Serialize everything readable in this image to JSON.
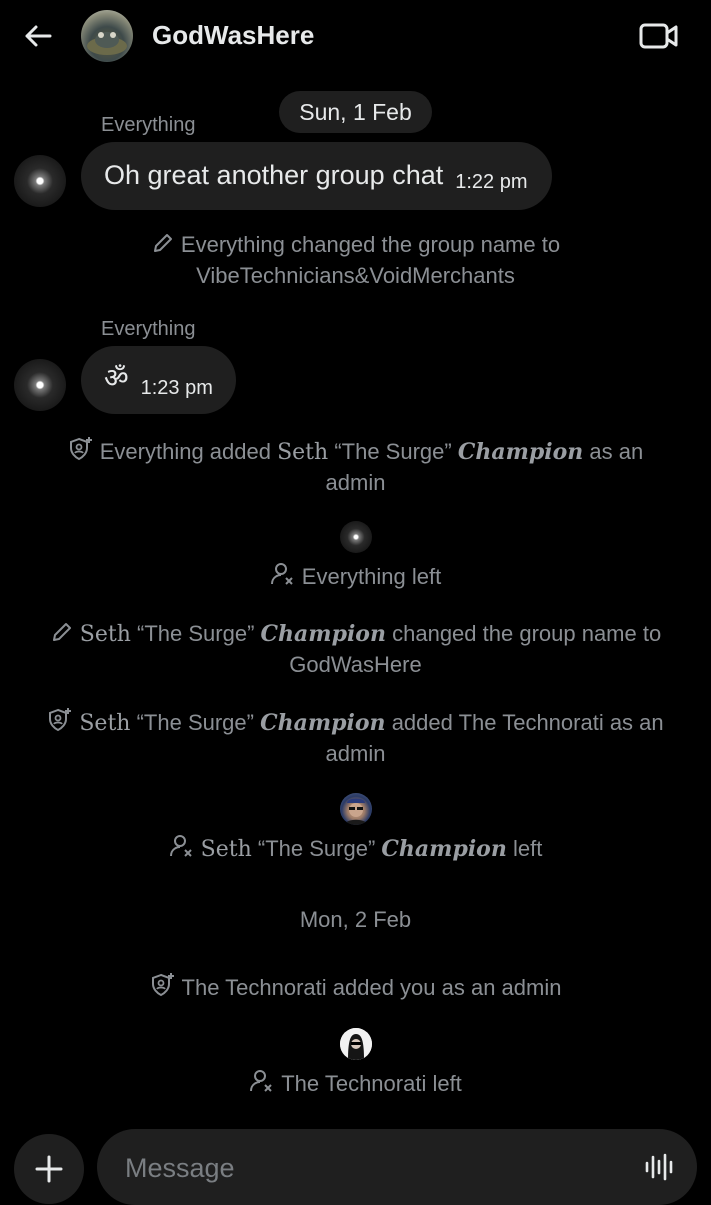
{
  "header": {
    "title": "GodWasHere",
    "back_icon": "arrow-left-icon",
    "video_icon": "video-call-icon"
  },
  "messages": {
    "date_1": "Sun, 1 Feb",
    "msg1": {
      "sender": "Everything",
      "text": "Oh great another group chat",
      "time": "1:22 pm"
    },
    "sys1": {
      "actor": "Everything",
      "text": "changed the group name to VibeTechnicians&VoidMerchants"
    },
    "msg2": {
      "sender": "Everything",
      "text": "ॐ",
      "time": "1:23 pm"
    },
    "sys2": {
      "pre": "Everything added",
      "name_a": "Seth",
      "name_b": "“The Surge”",
      "name_c": "Champion",
      "post": "as an admin"
    },
    "sys3": {
      "text": "Everything left"
    },
    "sys4": {
      "name_a": "Seth",
      "name_b": "“The Surge”",
      "name_c": "Champion",
      "post": "changed the group name to GodWasHere"
    },
    "sys5": {
      "name_a": "Seth",
      "name_b": "“The Surge”",
      "name_c": "Champion",
      "post": "added The Technorati as an admin"
    },
    "sys6": {
      "name_a": "Seth",
      "name_b": "“The Surge”",
      "name_c": "Champion",
      "post": "left"
    },
    "date_2": "Mon, 2 Feb",
    "sys7": {
      "text": "The Technorati added you as an admin"
    },
    "sys8": {
      "text": "The Technorati left"
    }
  },
  "composer": {
    "placeholder": "Message",
    "plus_icon": "plus-icon",
    "voice_icon": "voice-wave-icon"
  },
  "colors": {
    "background": "#000000",
    "bubble": "#1f1f1f",
    "muted_text": "#8b8f94",
    "primary_text": "#e7e9ea"
  }
}
